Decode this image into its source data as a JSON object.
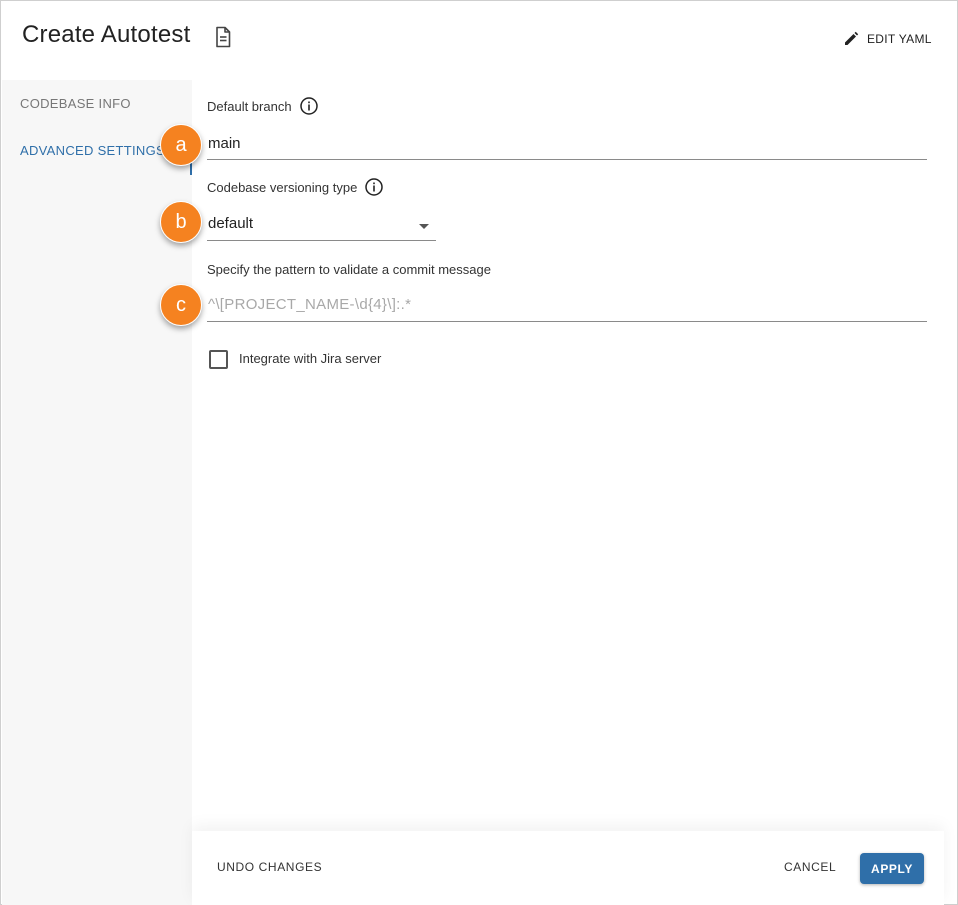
{
  "header": {
    "title": "Create Autotest",
    "edit_yaml_label": "EDIT YAML"
  },
  "sidebar": {
    "items": [
      {
        "label": "CODEBASE INFO",
        "active": false
      },
      {
        "label": "ADVANCED SETTINGS",
        "active": true
      }
    ]
  },
  "form": {
    "default_branch": {
      "label": "Default branch",
      "value": "main"
    },
    "versioning_type": {
      "label": "Codebase versioning type",
      "value": "default"
    },
    "commit_pattern": {
      "label": "Specify the pattern to validate a commit message",
      "placeholder": "^\\[PROJECT_NAME-\\d{4}\\]:.*"
    },
    "jira": {
      "label": "Integrate with Jira server",
      "checked": false
    }
  },
  "callouts": [
    "a",
    "b",
    "c"
  ],
  "footer": {
    "undo_label": "UNDO CHANGES",
    "cancel_label": "CANCEL",
    "apply_label": "APPLY"
  },
  "colors": {
    "accent": "#2f6fa9",
    "callout": "#f58220"
  }
}
